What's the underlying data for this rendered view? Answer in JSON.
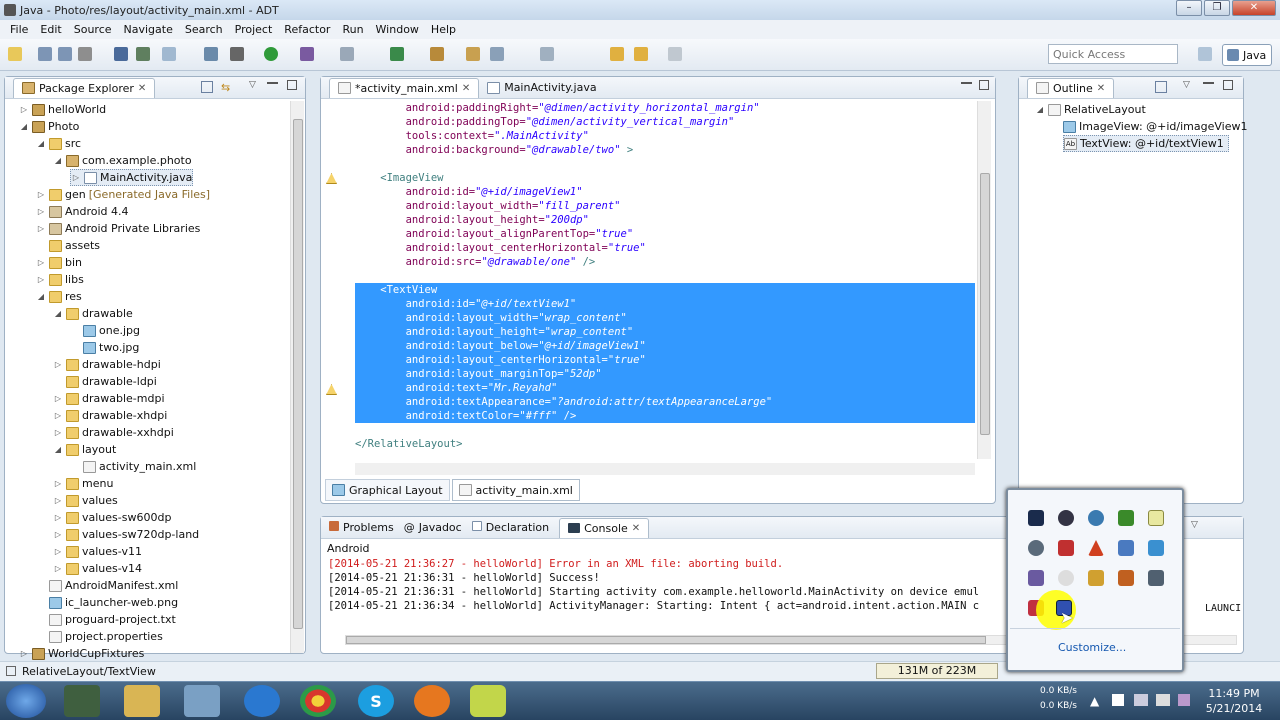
{
  "window": {
    "title": "Java - Photo/res/layout/activity_main.xml - ADT"
  },
  "menu": [
    "File",
    "Edit",
    "Source",
    "Navigate",
    "Search",
    "Project",
    "Refactor",
    "Run",
    "Window",
    "Help"
  ],
  "quick_access": {
    "placeholder": "Quick Access"
  },
  "perspective": {
    "label": "Java"
  },
  "package_explorer": {
    "title": "Package Explorer",
    "items": [
      {
        "label": "helloWorld"
      },
      {
        "label": "Photo"
      },
      {
        "label": "src"
      },
      {
        "label": "com.example.photo"
      },
      {
        "label": "MainActivity.java"
      },
      {
        "label": "gen",
        "suffix": "[Generated Java Files]"
      },
      {
        "label": "Android 4.4"
      },
      {
        "label": "Android Private Libraries"
      },
      {
        "label": "assets"
      },
      {
        "label": "bin"
      },
      {
        "label": "libs"
      },
      {
        "label": "res"
      },
      {
        "label": "drawable"
      },
      {
        "label": "one.jpg"
      },
      {
        "label": "two.jpg"
      },
      {
        "label": "drawable-hdpi"
      },
      {
        "label": "drawable-ldpi"
      },
      {
        "label": "drawable-mdpi"
      },
      {
        "label": "drawable-xhdpi"
      },
      {
        "label": "drawable-xxhdpi"
      },
      {
        "label": "layout"
      },
      {
        "label": "activity_main.xml"
      },
      {
        "label": "menu"
      },
      {
        "label": "values"
      },
      {
        "label": "values-sw600dp"
      },
      {
        "label": "values-sw720dp-land"
      },
      {
        "label": "values-v11"
      },
      {
        "label": "values-v14"
      },
      {
        "label": "AndroidManifest.xml"
      },
      {
        "label": "ic_launcher-web.png"
      },
      {
        "label": "proguard-project.txt"
      },
      {
        "label": "project.properties"
      },
      {
        "label": "WorldCupFixtures"
      }
    ]
  },
  "editor": {
    "tabs": [
      "*activity_main.xml",
      "MainActivity.java"
    ],
    "bottom_tabs": [
      "Graphical Layout",
      "activity_main.xml"
    ],
    "lines": [
      {
        "a": "        android:paddingRight=",
        "v": "\"@dimen/activity_horizontal_margin\""
      },
      {
        "a": "        android:paddingTop=",
        "v": "\"@dimen/activity_vertical_margin\""
      },
      {
        "a": "        tools:context=",
        "v": "\".MainActivity\""
      },
      {
        "a": "        android:background=",
        "v": "\"@drawable/two\"",
        "t": " >"
      },
      {
        "a": "",
        "v": ""
      },
      {
        "t": "    <ImageView"
      },
      {
        "a": "        android:id=",
        "v": "\"@+id/imageView1\""
      },
      {
        "a": "        android:layout_width=",
        "v": "\"fill_parent\""
      },
      {
        "a": "        android:layout_height=",
        "v": "\"200dp\""
      },
      {
        "a": "        android:layout_alignParentTop=",
        "v": "\"true\""
      },
      {
        "a": "        android:layout_centerHorizontal=",
        "v": "\"true\""
      },
      {
        "a": "        android:src=",
        "v": "\"@drawable/one\"",
        "t": " />"
      },
      {
        "a": "",
        "v": ""
      },
      {
        "t": "    <TextView",
        "sel": true
      },
      {
        "a": "        android:id=",
        "v": "\"@+id/textView1\"",
        "sel": true
      },
      {
        "a": "        android:layout_width=",
        "v": "\"wrap_content\"",
        "sel": true
      },
      {
        "a": "        android:layout_height=",
        "v": "\"wrap_content\"",
        "sel": true
      },
      {
        "a": "        android:layout_below=",
        "v": "\"@+id/imageView1\"",
        "sel": true
      },
      {
        "a": "        android:layout_centerHorizontal=",
        "v": "\"true\"",
        "sel": true
      },
      {
        "a": "        android:layout_marginTop=",
        "v": "\"52dp\"",
        "sel": true
      },
      {
        "a": "        android:text=",
        "v": "\"Mr.Reyahd\"",
        "sel": true
      },
      {
        "a": "        android:textAppearance=",
        "v": "\"?android:attr/textAppearanceLarge\"",
        "sel": true
      },
      {
        "a": "        android:textColor=",
        "v": "\"#fff\"",
        "t": " />",
        "sel": true
      },
      {
        "a": "",
        "v": ""
      },
      {
        "t": "</RelativeLayout>"
      }
    ]
  },
  "outline": {
    "title": "Outline",
    "items": [
      "RelativeLayout",
      "ImageView: @+id/imageView1",
      "TextView: @+id/textView1"
    ]
  },
  "console": {
    "tabs": [
      "Problems",
      "Javadoc",
      "Declaration",
      "Console"
    ],
    "label": "Android",
    "lines": [
      {
        "text": "[2014-05-21 21:36:27 - helloWorld] Error in an XML file: aborting build.",
        "error": true
      },
      {
        "text": "[2014-05-21 21:36:31 - helloWorld] Success!"
      },
      {
        "text": "[2014-05-21 21:36:31 - helloWorld] Starting activity com.example.helloworld.MainActivity on device emul"
      },
      {
        "text": "[2014-05-21 21:36:34 - helloWorld] ActivityManager: Starting: Intent { act=android.intent.action.MAIN c"
      }
    ],
    "overflow_text": "LAUNCI"
  },
  "status": {
    "path": "RelativeLayout/TextView",
    "heap": "131M of 223M"
  },
  "tray": {
    "customize": "Customize...",
    "speed1": "0.0 KB/s",
    "speed2": "0.0 KB/s"
  },
  "clock": {
    "time": "11:49 PM",
    "date": "5/21/2014"
  }
}
